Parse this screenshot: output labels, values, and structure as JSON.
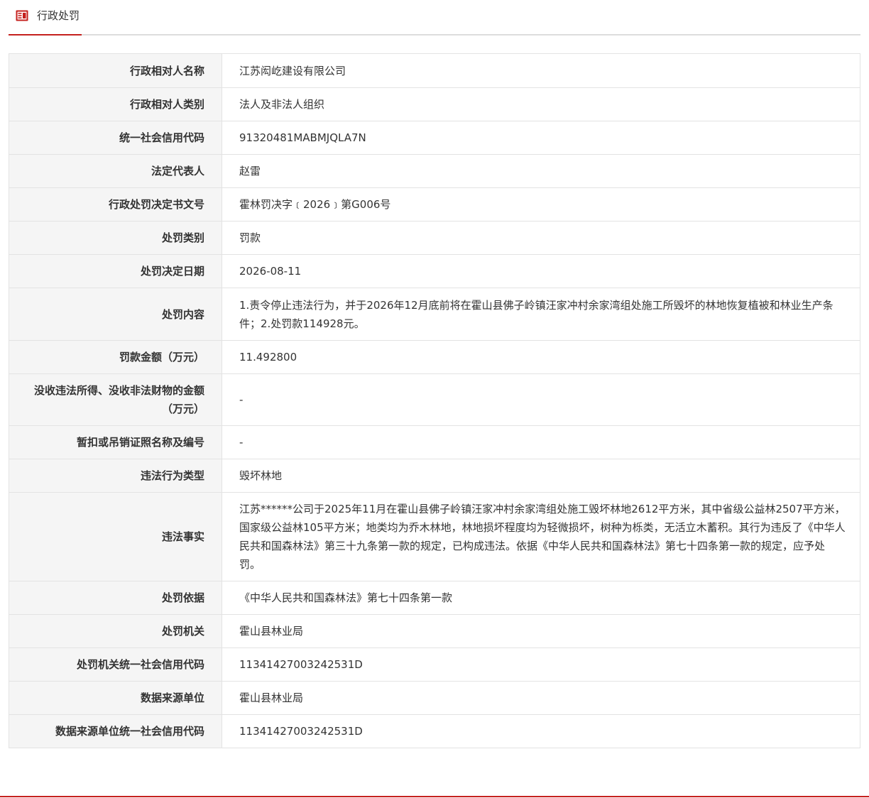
{
  "header": {
    "title": "行政处罚",
    "icon": "document-list-icon",
    "accent_color": "#c5211e"
  },
  "rows": [
    {
      "label": "行政相对人名称",
      "value": "江苏闳屹建设有限公司"
    },
    {
      "label": "行政相对人类别",
      "value": "法人及非法人组织"
    },
    {
      "label": "统一社会信用代码",
      "value": "91320481MABMJQLA7N"
    },
    {
      "label": "法定代表人",
      "value": "赵雷"
    },
    {
      "label": "行政处罚决定书文号",
      "value": "霍林罚决字﹝2026﹞第G006号"
    },
    {
      "label": "处罚类别",
      "value": "罚款"
    },
    {
      "label": "处罚决定日期",
      "value": "2026-08-11"
    },
    {
      "label": "处罚内容",
      "value": "1.责令停止违法行为，并于2026年12月底前将在霍山县佛子岭镇汪家冲村余家湾组处施工所毁坏的林地恢复植被和林业生产条件；2.处罚款114928元。"
    },
    {
      "label": "罚款金额（万元）",
      "value": "11.492800"
    },
    {
      "label": "没收违法所得、没收非法财物的金额（万元）",
      "value": "-"
    },
    {
      "label": "暂扣或吊销证照名称及编号",
      "value": "-"
    },
    {
      "label": "违法行为类型",
      "value": "毁坏林地"
    },
    {
      "label": "违法事实",
      "value": "江苏******公司于2025年11月在霍山县佛子岭镇汪家冲村余家湾组处施工毁坏林地2612平方米，其中省级公益林2507平方米，国家级公益林105平方米；地类均为乔木林地，林地损坏程度均为轻微损坏，树种为栎类，无活立木蓄积。其行为违反了《中华人民共和国森林法》第三十九条第一款的规定，已构成违法。依据《中华人民共和国森林法》第七十四条第一款的规定，应予处罚。"
    },
    {
      "label": "处罚依据",
      "value": "《中华人民共和国森林法》第七十四条第一款"
    },
    {
      "label": "处罚机关",
      "value": "霍山县林业局"
    },
    {
      "label": "处罚机关统一社会信用代码",
      "value": "11341427003242531D"
    },
    {
      "label": "数据来源单位",
      "value": "霍山县林业局"
    },
    {
      "label": "数据来源单位统一社会信用代码",
      "value": "11341427003242531D"
    }
  ]
}
